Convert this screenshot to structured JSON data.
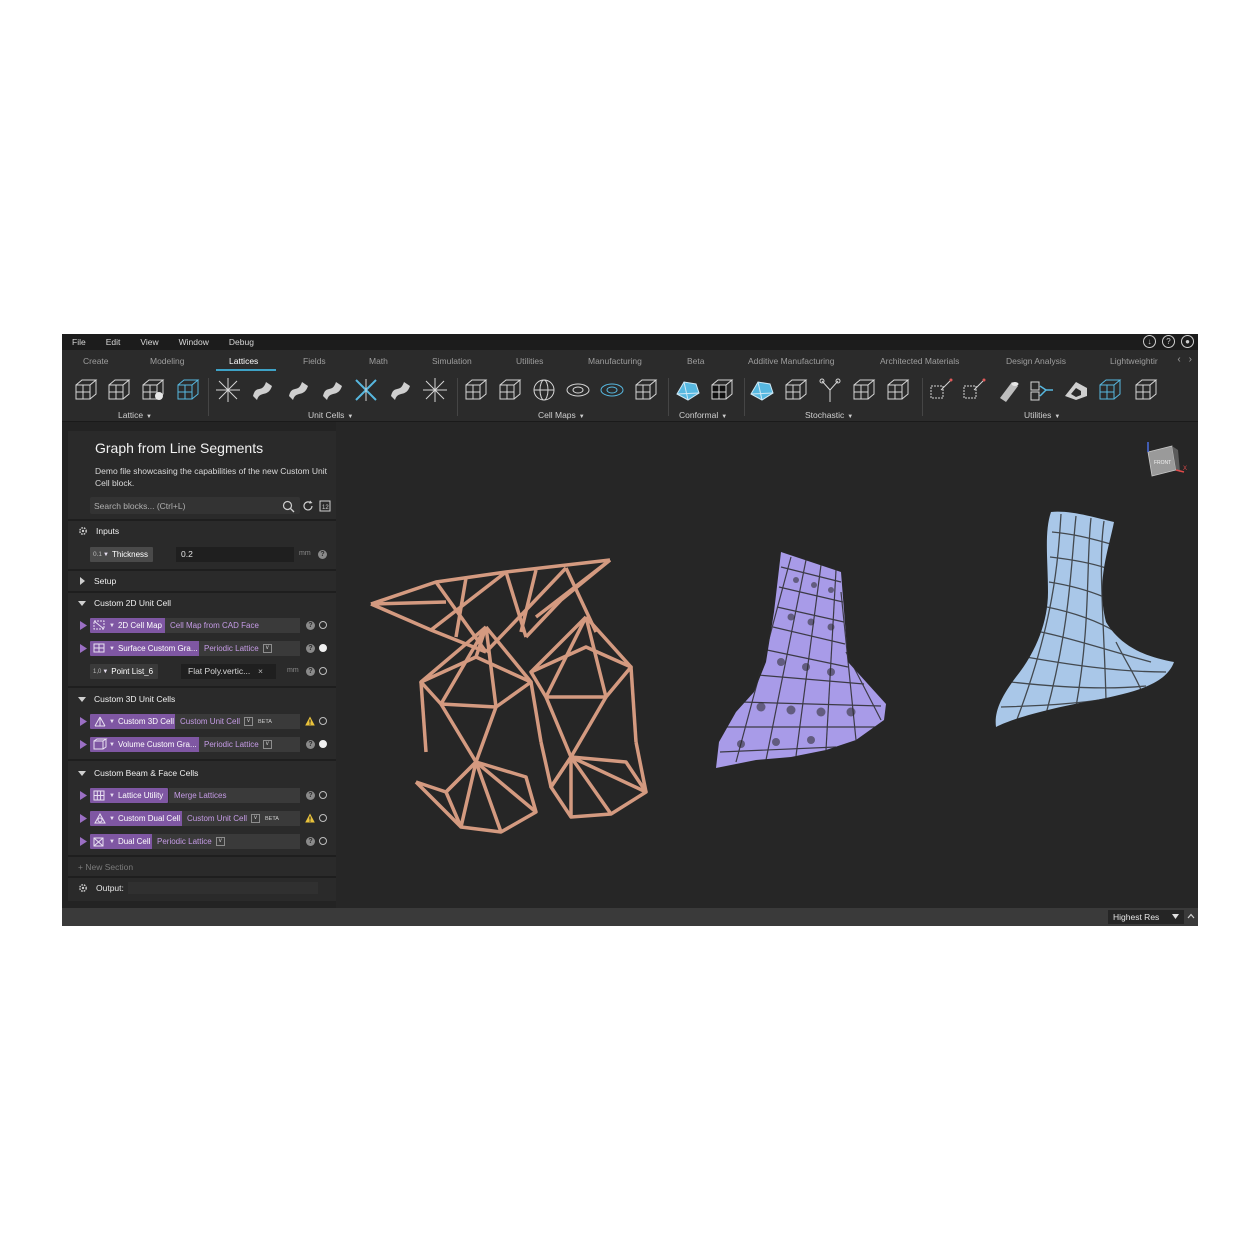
{
  "menu": [
    "File",
    "Edit",
    "View",
    "Window",
    "Debug"
  ],
  "tabs": [
    {
      "label": "Create",
      "active": false
    },
    {
      "label": "Modeling",
      "active": false
    },
    {
      "label": "Lattices",
      "active": true
    },
    {
      "label": "Fields",
      "active": false
    },
    {
      "label": "Math",
      "active": false
    },
    {
      "label": "Simulation",
      "active": false
    },
    {
      "label": "Utilities",
      "active": false
    },
    {
      "label": "Manufacturing",
      "active": false
    },
    {
      "label": "Beta",
      "active": false
    },
    {
      "label": "Additive Manufacturing",
      "active": false
    },
    {
      "label": "Architected Materials",
      "active": false
    },
    {
      "label": "Design Analysis",
      "active": false
    },
    {
      "label": "Lightweightir",
      "active": false
    }
  ],
  "toolbar_groups": [
    "Lattice",
    "Unit Cells",
    "Cell Maps",
    "Conformal",
    "Stochastic",
    "Utilities"
  ],
  "panel": {
    "title": "Graph from Line Segments",
    "description": "Demo file showcasing the capabilities of the new Custom Unit Cell block.",
    "search_placeholder": "Search blocks... (Ctrl+L)",
    "inputs_label": "Inputs",
    "thickness": {
      "badge": "0.1",
      "label": "Thickness",
      "value": "0.2",
      "unit": "mm"
    },
    "setup_label": "Setup",
    "sections": [
      {
        "title": "Custom 2D Unit Cell",
        "rows": [
          {
            "block": "2D Cell Map",
            "type": "Cell Map from CAD Face",
            "dropdown": false,
            "beta": false,
            "warn": false,
            "filled": false
          },
          {
            "block": "Surface Custom Gra...",
            "type": "Periodic Lattice",
            "dropdown": true,
            "beta": false,
            "warn": false,
            "filled": true
          }
        ],
        "point_row": {
          "block": "Point List_6",
          "value": "Flat Poly.vertic...",
          "unit": "mm"
        }
      },
      {
        "title": "Custom 3D Unit Cells",
        "rows": [
          {
            "block": "Custom 3D Cell",
            "type": "Custom Unit Cell",
            "dropdown": true,
            "beta": true,
            "warn": true,
            "filled": false
          },
          {
            "block": "Volume Custom Gra...",
            "type": "Periodic Lattice",
            "dropdown": true,
            "beta": false,
            "warn": false,
            "filled": true
          }
        ]
      },
      {
        "title": "Custom Beam & Face Cells",
        "rows": [
          {
            "block": "Lattice Utility",
            "type": "Merge Lattices",
            "dropdown": false,
            "beta": false,
            "warn": false,
            "filled": false
          },
          {
            "block": "Custom Dual Cell",
            "type": "Custom Unit Cell",
            "dropdown": true,
            "beta": true,
            "warn": true,
            "filled": false
          },
          {
            "block": "Dual Cell",
            "type": "Periodic Lattice",
            "dropdown": true,
            "beta": false,
            "warn": false,
            "filled": false
          }
        ]
      }
    ],
    "beta_label": "BETA",
    "new_section": "New Section",
    "output_label": "Output:"
  },
  "viewcube_label": "FRONT",
  "viewcube_axis": "X",
  "resolution": "Highest Res",
  "colors": {
    "accent": "#3ea2c6",
    "block": "#7f57a3",
    "type_text": "#c59be6",
    "lattice_copper": "#d49a80",
    "lattice_purple": "#a89be8",
    "lattice_blue": "#a9c7e8"
  }
}
